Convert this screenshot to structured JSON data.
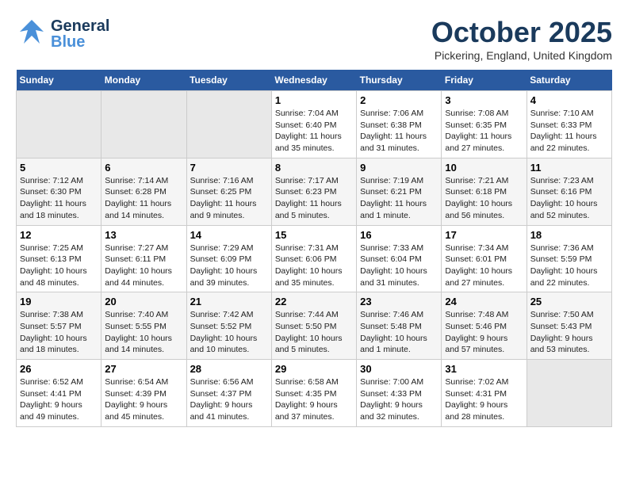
{
  "header": {
    "logo_general": "General",
    "logo_blue": "Blue",
    "month": "October 2025",
    "location": "Pickering, England, United Kingdom"
  },
  "weekdays": [
    "Sunday",
    "Monday",
    "Tuesday",
    "Wednesday",
    "Thursday",
    "Friday",
    "Saturday"
  ],
  "weeks": [
    [
      {
        "day": "",
        "info": ""
      },
      {
        "day": "",
        "info": ""
      },
      {
        "day": "",
        "info": ""
      },
      {
        "day": "1",
        "info": "Sunrise: 7:04 AM\nSunset: 6:40 PM\nDaylight: 11 hours\nand 35 minutes."
      },
      {
        "day": "2",
        "info": "Sunrise: 7:06 AM\nSunset: 6:38 PM\nDaylight: 11 hours\nand 31 minutes."
      },
      {
        "day": "3",
        "info": "Sunrise: 7:08 AM\nSunset: 6:35 PM\nDaylight: 11 hours\nand 27 minutes."
      },
      {
        "day": "4",
        "info": "Sunrise: 7:10 AM\nSunset: 6:33 PM\nDaylight: 11 hours\nand 22 minutes."
      }
    ],
    [
      {
        "day": "5",
        "info": "Sunrise: 7:12 AM\nSunset: 6:30 PM\nDaylight: 11 hours\nand 18 minutes."
      },
      {
        "day": "6",
        "info": "Sunrise: 7:14 AM\nSunset: 6:28 PM\nDaylight: 11 hours\nand 14 minutes."
      },
      {
        "day": "7",
        "info": "Sunrise: 7:16 AM\nSunset: 6:25 PM\nDaylight: 11 hours\nand 9 minutes."
      },
      {
        "day": "8",
        "info": "Sunrise: 7:17 AM\nSunset: 6:23 PM\nDaylight: 11 hours\nand 5 minutes."
      },
      {
        "day": "9",
        "info": "Sunrise: 7:19 AM\nSunset: 6:21 PM\nDaylight: 11 hours\nand 1 minute."
      },
      {
        "day": "10",
        "info": "Sunrise: 7:21 AM\nSunset: 6:18 PM\nDaylight: 10 hours\nand 56 minutes."
      },
      {
        "day": "11",
        "info": "Sunrise: 7:23 AM\nSunset: 6:16 PM\nDaylight: 10 hours\nand 52 minutes."
      }
    ],
    [
      {
        "day": "12",
        "info": "Sunrise: 7:25 AM\nSunset: 6:13 PM\nDaylight: 10 hours\nand 48 minutes."
      },
      {
        "day": "13",
        "info": "Sunrise: 7:27 AM\nSunset: 6:11 PM\nDaylight: 10 hours\nand 44 minutes."
      },
      {
        "day": "14",
        "info": "Sunrise: 7:29 AM\nSunset: 6:09 PM\nDaylight: 10 hours\nand 39 minutes."
      },
      {
        "day": "15",
        "info": "Sunrise: 7:31 AM\nSunset: 6:06 PM\nDaylight: 10 hours\nand 35 minutes."
      },
      {
        "day": "16",
        "info": "Sunrise: 7:33 AM\nSunset: 6:04 PM\nDaylight: 10 hours\nand 31 minutes."
      },
      {
        "day": "17",
        "info": "Sunrise: 7:34 AM\nSunset: 6:01 PM\nDaylight: 10 hours\nand 27 minutes."
      },
      {
        "day": "18",
        "info": "Sunrise: 7:36 AM\nSunset: 5:59 PM\nDaylight: 10 hours\nand 22 minutes."
      }
    ],
    [
      {
        "day": "19",
        "info": "Sunrise: 7:38 AM\nSunset: 5:57 PM\nDaylight: 10 hours\nand 18 minutes."
      },
      {
        "day": "20",
        "info": "Sunrise: 7:40 AM\nSunset: 5:55 PM\nDaylight: 10 hours\nand 14 minutes."
      },
      {
        "day": "21",
        "info": "Sunrise: 7:42 AM\nSunset: 5:52 PM\nDaylight: 10 hours\nand 10 minutes."
      },
      {
        "day": "22",
        "info": "Sunrise: 7:44 AM\nSunset: 5:50 PM\nDaylight: 10 hours\nand 5 minutes."
      },
      {
        "day": "23",
        "info": "Sunrise: 7:46 AM\nSunset: 5:48 PM\nDaylight: 10 hours\nand 1 minute."
      },
      {
        "day": "24",
        "info": "Sunrise: 7:48 AM\nSunset: 5:46 PM\nDaylight: 9 hours\nand 57 minutes."
      },
      {
        "day": "25",
        "info": "Sunrise: 7:50 AM\nSunset: 5:43 PM\nDaylight: 9 hours\nand 53 minutes."
      }
    ],
    [
      {
        "day": "26",
        "info": "Sunrise: 6:52 AM\nSunset: 4:41 PM\nDaylight: 9 hours\nand 49 minutes."
      },
      {
        "day": "27",
        "info": "Sunrise: 6:54 AM\nSunset: 4:39 PM\nDaylight: 9 hours\nand 45 minutes."
      },
      {
        "day": "28",
        "info": "Sunrise: 6:56 AM\nSunset: 4:37 PM\nDaylight: 9 hours\nand 41 minutes."
      },
      {
        "day": "29",
        "info": "Sunrise: 6:58 AM\nSunset: 4:35 PM\nDaylight: 9 hours\nand 37 minutes."
      },
      {
        "day": "30",
        "info": "Sunrise: 7:00 AM\nSunset: 4:33 PM\nDaylight: 9 hours\nand 32 minutes."
      },
      {
        "day": "31",
        "info": "Sunrise: 7:02 AM\nSunset: 4:31 PM\nDaylight: 9 hours\nand 28 minutes."
      },
      {
        "day": "",
        "info": ""
      }
    ]
  ]
}
